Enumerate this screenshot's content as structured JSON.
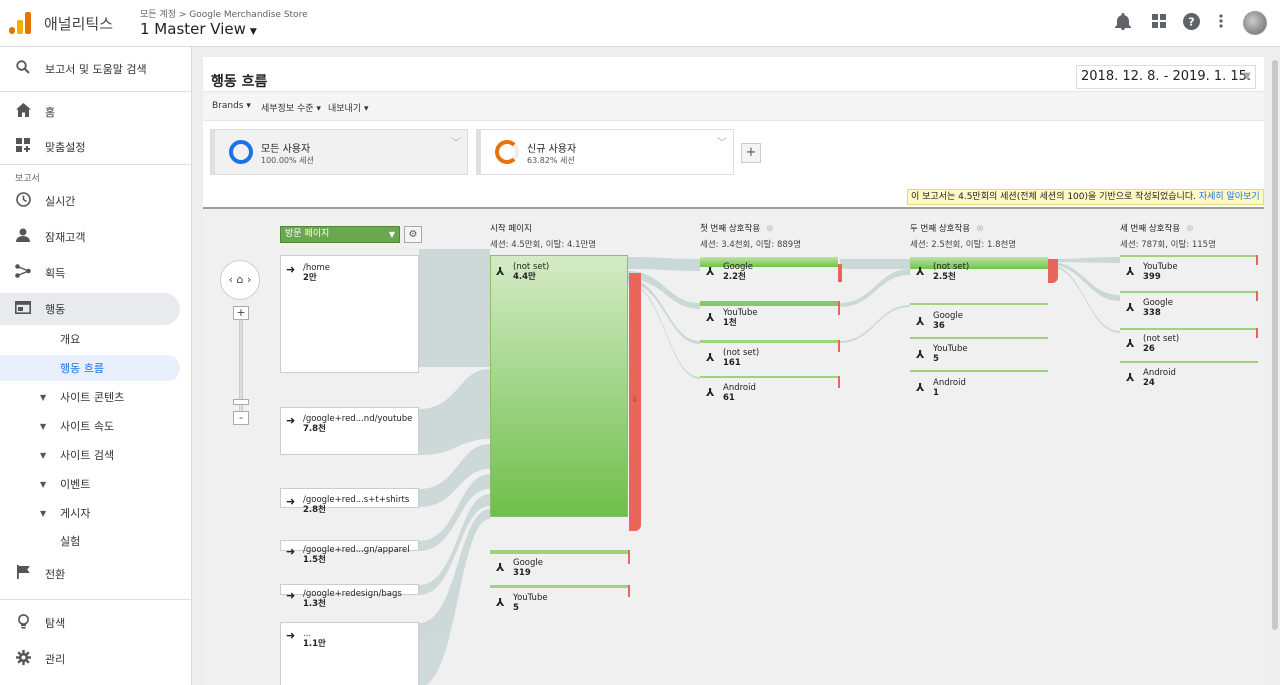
{
  "app": {
    "name": "애널리틱스",
    "breadcrumb": "모든 계정 > Google Merchandise Store",
    "view": "1 Master View"
  },
  "topbar_icons": [
    "bell-icon",
    "apps-icon",
    "help-icon",
    "more-icon"
  ],
  "sidebar": {
    "search": "보고서 및 도움말 검색",
    "home": "홈",
    "custom": "맞춤설정",
    "section": "보고서",
    "realtime": "실시간",
    "audience": "잠재고객",
    "acquisition": "획득",
    "behavior": "행동",
    "overview": "개요",
    "behavior_flow": "행동 흐름",
    "site_content": "사이트 콘텐츠",
    "site_speed": "사이트 속도",
    "site_search": "사이트 검색",
    "events": "이벤트",
    "publisher": "게시자",
    "experiments": "실험",
    "conversions": "전환",
    "discover": "탐색",
    "admin": "관리"
  },
  "report": {
    "title": "행동 흐름",
    "date_range": "2018. 12. 8. - 2019. 1. 15.",
    "toolbar": {
      "brands": "Brands",
      "detail": "세부정보 수준",
      "export": "내보내기"
    },
    "segments": [
      {
        "name": "모든 사용자",
        "pct": "100.00% 세션",
        "color": "#1a73e8"
      },
      {
        "name": "신규 사용자",
        "pct": "63.82% 세션",
        "color": "#e8710a"
      }
    ],
    "notice": "이 보고서는 4.5만회의 세션(전체 세션의 100)을 기반으로 작성되었습니다.",
    "notice_link": "자세히 알아보기"
  },
  "flow": {
    "dimension": "방문 페이지",
    "columns": [
      {
        "title": "시작 페이지",
        "stats": "세션: 4.5만회, 이탈: 4.1만명"
      },
      {
        "title": "첫 번째 상호작용",
        "stats": "세션: 3.4천회, 이탈: 889명"
      },
      {
        "title": "두 번째 상호작용",
        "stats": "세션: 2.5천회, 이탈: 1.8천명"
      },
      {
        "title": "세 번째 상호작용",
        "stats": "세션: 787회, 이탈: 115명"
      }
    ],
    "landing": [
      {
        "name": "/home",
        "value": "2만"
      },
      {
        "name": "/google+red...nd/youtube",
        "value": "7.8천"
      },
      {
        "name": "/google+red...s+t+shirts",
        "value": "2.8천"
      },
      {
        "name": "/google+red...gn/apparel",
        "value": "1.5천"
      },
      {
        "name": "/google+redesign/bags",
        "value": "1.3천"
      },
      {
        "name": "...",
        "value": "1.1만"
      }
    ],
    "start": [
      {
        "name": "(not set)",
        "value": "4.4만"
      },
      {
        "name": "Google",
        "value": "319"
      },
      {
        "name": "YouTube",
        "value": "5"
      }
    ],
    "first": [
      {
        "name": "Google",
        "value": "2.2천"
      },
      {
        "name": "YouTube",
        "value": "1천"
      },
      {
        "name": "(not set)",
        "value": "161"
      },
      {
        "name": "Android",
        "value": "61"
      }
    ],
    "second": [
      {
        "name": "(not set)",
        "value": "2.5천"
      },
      {
        "name": "Google",
        "value": "36"
      },
      {
        "name": "YouTube",
        "value": "5"
      },
      {
        "name": "Android",
        "value": "1"
      }
    ],
    "third": [
      {
        "name": "YouTube",
        "value": "399"
      },
      {
        "name": "Google",
        "value": "338"
      },
      {
        "name": "(not set)",
        "value": "26"
      },
      {
        "name": "Android",
        "value": "24"
      }
    ]
  }
}
